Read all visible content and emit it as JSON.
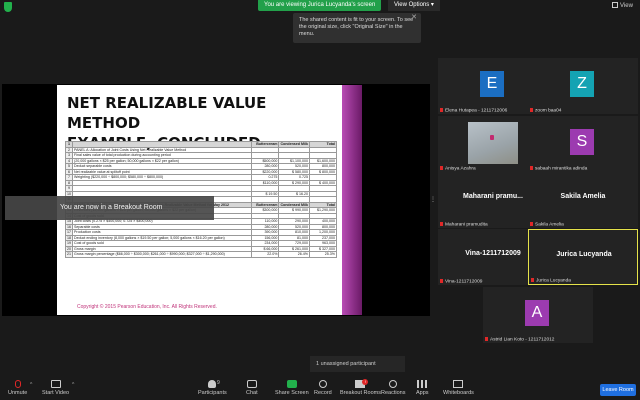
{
  "topbar": {
    "viewing_label": "You are viewing Jurica Lucyanda's screen",
    "view_options_label": "View Options ▾",
    "view_label": "View"
  },
  "tooltip": {
    "text": "The shared content is fit to your screen. To see the original size, click \"Original Size\" in the menu.",
    "close": "✕"
  },
  "slide": {
    "title_line1": "NET REALIZABLE VALUE METHOD",
    "title_line2": "EXAMPLE, CONCLUDED",
    "copyright": "Copyright © 2015 Pearson Education, Inc. All Rights Reserved.",
    "columns": [
      "",
      "A",
      "B",
      "C",
      "D"
    ],
    "rows": [
      {
        "n": "1",
        "label": "",
        "b": "Buttercream",
        "c": "Condensed Milk",
        "d": "Total",
        "hdr": true
      },
      {
        "n": "2",
        "label": "PANEL A: Allocation of Joint Costs Using Net Realizable Value Method",
        "b": "",
        "c": "",
        "d": ""
      },
      {
        "n": "3",
        "label": "Final sales value of total production during accounting period",
        "b": "",
        "c": "",
        "d": ""
      },
      {
        "n": "4",
        "label": "(20,000 gallons × $25 per gallon; 50,000 gallons × $22 per gallon)",
        "b": "$500,000",
        "c": "$1,100,000",
        "d": "$1,600,000"
      },
      {
        "n": "5",
        "label": "Deduct separable costs",
        "b": "280,000",
        "c": "520,000",
        "d": "800,000"
      },
      {
        "n": "6",
        "label": "Net realizable value at splitoff point",
        "b": "$220,000",
        "c": "$ 580,000",
        "d": "$ 800,000"
      },
      {
        "n": "7",
        "label": "Weighting ($220,000 ÷ $800,000; $580,000 ÷ $800,000)",
        "b": "0.275",
        "c": "0.725",
        "d": ""
      },
      {
        "n": "8",
        "label": "",
        "b": "$110,000",
        "c": "$ 290,000",
        "d": "$ 400,000"
      },
      {
        "n": "9",
        "label": "",
        "b": "",
        "c": "",
        "d": ""
      },
      {
        "n": "10",
        "label": "",
        "b": "$ 19.50",
        "c": "$ 16.20",
        "d": ""
      },
      {
        "n": "11",
        "label": "",
        "b": "",
        "c": "",
        "d": ""
      },
      {
        "n": "12",
        "label": "PANEL B: Product-Line Income Statement Using Net Realizable Value Method for May 2012",
        "b": "Buttercream",
        "c": "Condensed Milk",
        "d": "Total",
        "hdr": true
      },
      {
        "n": "13",
        "label": "Revenues (12,000 gallons × $25 per gallon; 45,000 gallons × $22 per gallon)",
        "b": "$300,000",
        "c": "$ 990,000",
        "d": "$1,290,000"
      },
      {
        "n": "14",
        "label": "Cost of goods sold",
        "b": "",
        "c": "",
        "d": ""
      },
      {
        "n": "15",
        "label": "Joint costs (0.275 × $400,000; 0.725 × $400,000)",
        "b": "110,000",
        "c": "290,000",
        "d": "400,000"
      },
      {
        "n": "16",
        "label": "Separable costs",
        "b": "280,000",
        "c": "520,000",
        "d": "800,000"
      },
      {
        "n": "17",
        "label": "Production costs",
        "b": "390,000",
        "c": "810,000",
        "d": "1,200,000"
      },
      {
        "n": "18",
        "label": "Deduct ending inventory (8,000 gallons × $19.50 per gallon; 5,000 gallons × $16.20 per gallon)",
        "b": "156,000",
        "c": "81,000",
        "d": "237,000"
      },
      {
        "n": "19",
        "label": "Cost of goods sold",
        "b": "234,000",
        "c": "729,000",
        "d": "963,000"
      },
      {
        "n": "20",
        "label": "Gross margin",
        "b": "$ 66,000",
        "c": "$ 261,000",
        "d": "$ 327,000"
      },
      {
        "n": "21",
        "label": "Gross margin percentage ($66,000 ÷ $300,000; $261,000 ÷ $990,000; $327,000 ÷ $1,290,000)",
        "b": "22.0%",
        "c": "26.4%",
        "d": "25.3%"
      }
    ]
  },
  "breakout_banner": "You are now in a Breakout Room",
  "participants": [
    {
      "avatar": "E",
      "color": "#1b6ec2",
      "name": "Elena Hutapea - 1211712006",
      "type": "avatar"
    },
    {
      "avatar": "Z",
      "color": "#14a3b3",
      "name": "zoom baa04",
      "type": "avatar"
    },
    {
      "avatar": "",
      "color": "",
      "name": "Anisya Azahra",
      "type": "photo"
    },
    {
      "avatar": "S",
      "color": "#9c3bb0",
      "name": "sabaah mirantika adinda",
      "type": "avatar"
    },
    {
      "big": "Maharani  pramu...",
      "name": "Maharani pramudita",
      "type": "text"
    },
    {
      "big": "Sakila Amelia",
      "name": "Sakila Amelia",
      "type": "text"
    },
    {
      "big": "Vina-1211712009",
      "name": "Vina-1211712009",
      "type": "text"
    },
    {
      "big": "Jurica Lucyanda",
      "name": "Jurica Lucyanda",
      "type": "text",
      "active": true
    },
    {
      "avatar": "A",
      "color": "#9c3bb0",
      "name": "Astrid Lian Koto - 1211712012",
      "type": "avatar"
    }
  ],
  "unassigned": "1 unassigned participant",
  "toolbar": {
    "unmute": "Unmute",
    "start_video": "Start Video",
    "participants": "Participants",
    "participants_count": "9",
    "chat": "Chat",
    "share_screen": "Share Screen",
    "record": "Record",
    "breakout_rooms": "Breakout Rooms",
    "reactions": "Reactions",
    "apps": "Apps",
    "whiteboards": "Whiteboards",
    "leave_room": "Leave Room"
  },
  "colors": {
    "share_green": "#22b14c",
    "leave_blue": "#1f6fe0",
    "active_speaker": "#e5e24a",
    "muted_red": "#e02828"
  }
}
